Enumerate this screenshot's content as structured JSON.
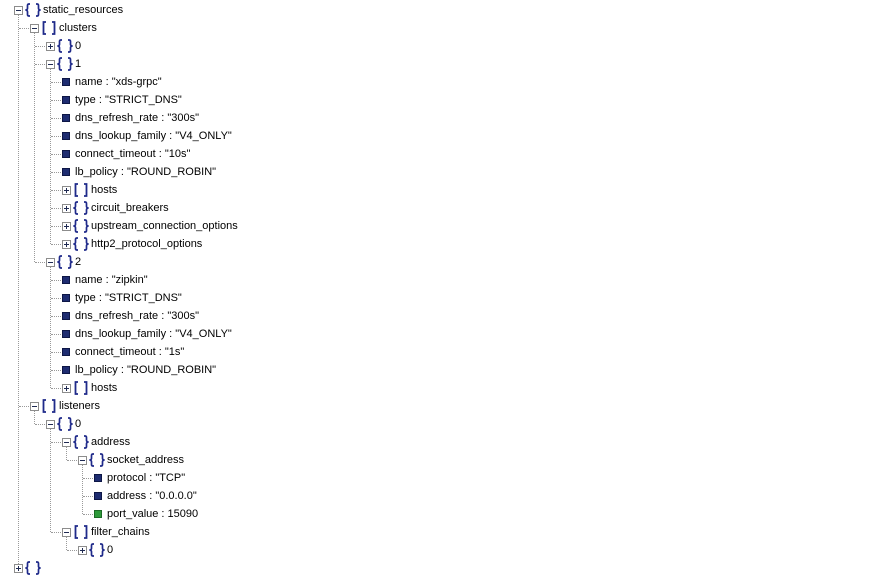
{
  "nodes": [
    {
      "d": 0,
      "t": "obj",
      "ex": true,
      "label": "static_resources"
    },
    {
      "d": 1,
      "t": "arr",
      "ex": true,
      "label": "clusters"
    },
    {
      "d": 2,
      "t": "obj",
      "ex": false,
      "label": "0"
    },
    {
      "d": 2,
      "t": "obj",
      "ex": true,
      "label": "1"
    },
    {
      "d": 3,
      "t": "str",
      "key": "name",
      "val": "\"xds-grpc\""
    },
    {
      "d": 3,
      "t": "str",
      "key": "type",
      "val": "\"STRICT_DNS\""
    },
    {
      "d": 3,
      "t": "str",
      "key": "dns_refresh_rate",
      "val": "\"300s\""
    },
    {
      "d": 3,
      "t": "str",
      "key": "dns_lookup_family",
      "val": "\"V4_ONLY\""
    },
    {
      "d": 3,
      "t": "str",
      "key": "connect_timeout",
      "val": "\"10s\""
    },
    {
      "d": 3,
      "t": "str",
      "key": "lb_policy",
      "val": "\"ROUND_ROBIN\""
    },
    {
      "d": 3,
      "t": "arr",
      "ex": false,
      "label": "hosts"
    },
    {
      "d": 3,
      "t": "obj",
      "ex": false,
      "label": "circuit_breakers"
    },
    {
      "d": 3,
      "t": "obj",
      "ex": false,
      "label": "upstream_connection_options"
    },
    {
      "d": 3,
      "t": "obj",
      "ex": false,
      "label": "http2_protocol_options"
    },
    {
      "d": 2,
      "t": "obj",
      "ex": true,
      "label": "2"
    },
    {
      "d": 3,
      "t": "str",
      "key": "name",
      "val": "\"zipkin\""
    },
    {
      "d": 3,
      "t": "str",
      "key": "type",
      "val": "\"STRICT_DNS\""
    },
    {
      "d": 3,
      "t": "str",
      "key": "dns_refresh_rate",
      "val": "\"300s\""
    },
    {
      "d": 3,
      "t": "str",
      "key": "dns_lookup_family",
      "val": "\"V4_ONLY\""
    },
    {
      "d": 3,
      "t": "str",
      "key": "connect_timeout",
      "val": "\"1s\""
    },
    {
      "d": 3,
      "t": "str",
      "key": "lb_policy",
      "val": "\"ROUND_ROBIN\""
    },
    {
      "d": 3,
      "t": "arr",
      "ex": false,
      "label": "hosts"
    },
    {
      "d": 1,
      "t": "arr",
      "ex": true,
      "label": "listeners"
    },
    {
      "d": 2,
      "t": "obj",
      "ex": true,
      "label": "0"
    },
    {
      "d": 3,
      "t": "obj",
      "ex": true,
      "label": "address"
    },
    {
      "d": 4,
      "t": "obj",
      "ex": true,
      "label": "socket_address"
    },
    {
      "d": 5,
      "t": "str",
      "key": "protocol",
      "val": "\"TCP\""
    },
    {
      "d": 5,
      "t": "str",
      "key": "address",
      "val": "\"0.0.0.0\""
    },
    {
      "d": 5,
      "t": "num",
      "key": "port_value",
      "val": "15090"
    },
    {
      "d": 3,
      "t": "arr",
      "ex": true,
      "label": "filter_chains"
    },
    {
      "d": 4,
      "t": "obj",
      "ex": false,
      "label": "0"
    },
    {
      "d": 0,
      "t": "obj",
      "ex": false,
      "label": ""
    }
  ],
  "icons": {
    "obj": "curly-braces-icon",
    "arr": "square-brackets-icon",
    "str": "string-value-icon",
    "num": "number-value-icon",
    "expanded": "collapse-minus-icon",
    "collapsed": "expand-plus-icon"
  },
  "colors": {
    "bracket": "#1f2a8a",
    "string_leaf": "#1e2c70",
    "number_leaf": "#2e9a3a",
    "guide_line": "#9a9a9a"
  }
}
